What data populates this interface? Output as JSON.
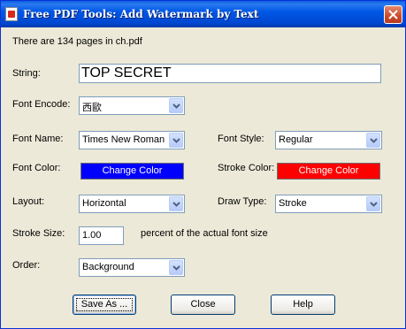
{
  "window": {
    "title": "Free PDF Tools: Add Watermark by Text"
  },
  "info_text": "There are 134 pages in ch.pdf",
  "fields": {
    "string": {
      "label": "String:",
      "value": "TOP SECRET"
    },
    "font_encode": {
      "label": "Font Encode:",
      "value": "西歐"
    },
    "font_name": {
      "label": "Font Name:",
      "value": "Times New Roman"
    },
    "font_style": {
      "label": "Font Style:",
      "value": "Regular"
    },
    "font_color": {
      "label": "Font Color:",
      "button": "Change Color",
      "color": "#0000ff"
    },
    "stroke_color": {
      "label": "Stroke Color:",
      "button": "Change Color",
      "color": "#ff0000"
    },
    "layout": {
      "label": "Layout:",
      "value": "Horizontal"
    },
    "draw_type": {
      "label": "Draw Type:",
      "value": "Stroke"
    },
    "stroke_size": {
      "label": "Stroke Size:",
      "value": "1.00",
      "suffix": "percent of the actual font size"
    },
    "order": {
      "label": "Order:",
      "value": "Background"
    }
  },
  "buttons": {
    "save_as": "Save As ...",
    "close": "Close",
    "help": "Help"
  },
  "icons": {
    "close": "close-icon",
    "dropdown": "chevron-down-icon",
    "app": "pdf-app-icon"
  },
  "colors": {
    "titlebar": "#0054e3",
    "dialog_bg": "#ece9d8",
    "close_button": "#cc4a2a"
  }
}
